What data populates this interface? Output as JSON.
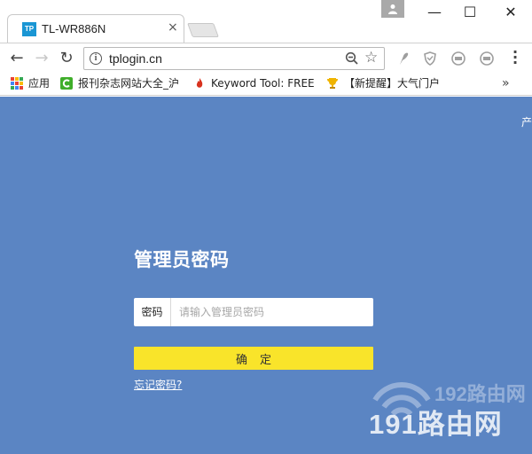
{
  "browser": {
    "tab": {
      "favicon_text": "TP",
      "title": "TL-WR886N",
      "close": "×"
    },
    "window_controls": {
      "minimize": "—",
      "maximize": "☐",
      "close": "✕"
    },
    "nav": {
      "back": "←",
      "forward": "→",
      "reload": "↻"
    },
    "address_bar": {
      "url": "tplogin.cn"
    },
    "menu": "⋮",
    "extensions": [
      "feather-extension-icon",
      "shield-extension-icon",
      "ad-block-extension-icon",
      "ad-block-2-extension-icon"
    ]
  },
  "bookmarks": {
    "items": [
      {
        "label": "应用",
        "icon": "apps-grid-icon"
      },
      {
        "label": "报刊杂志网站大全_沪",
        "icon": "green-c-icon"
      },
      {
        "label": "Keyword Tool: FREE",
        "icon": "flame-icon"
      },
      {
        "label": "【新提醒】大气门户",
        "icon": "trophy-icon"
      }
    ],
    "more": "»"
  },
  "page": {
    "top_right_label": "产",
    "title": "管理员密码",
    "password": {
      "label": "密码",
      "placeholder": "请输入管理员密码",
      "value": ""
    },
    "submit_label": "确定",
    "forgot_link": "忘记密码?"
  },
  "watermark": {
    "top_text": "192路由网",
    "bottom_text": "191路由网"
  },
  "colors": {
    "page_background": "#5b85c3",
    "button": "#f9e42a",
    "favicon": "#1a96d4"
  }
}
